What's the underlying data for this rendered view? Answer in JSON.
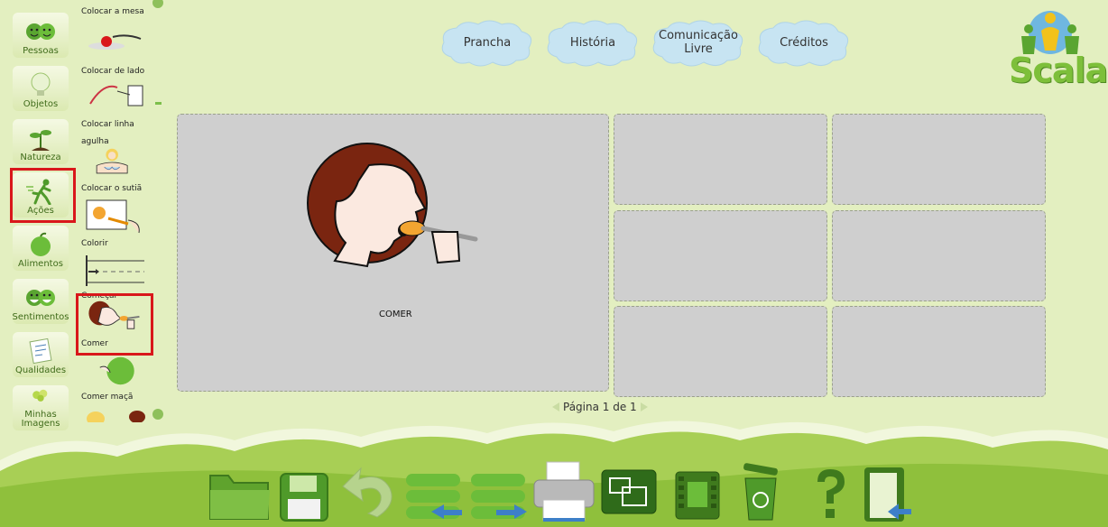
{
  "brand": {
    "logo_text": "Scala"
  },
  "nav_tabs": [
    {
      "label": "Prancha"
    },
    {
      "label": "História"
    },
    {
      "label": "Comunicação Livre"
    },
    {
      "label": "Créditos"
    }
  ],
  "categories": [
    {
      "label": "Pessoas",
      "icon": "people-icon"
    },
    {
      "label": "Objetos",
      "icon": "lightbulb-icon"
    },
    {
      "label": "Natureza",
      "icon": "plant-icon"
    },
    {
      "label": "Ações",
      "icon": "running-person-icon",
      "selected": true
    },
    {
      "label": "Alimentos",
      "icon": "apple-icon"
    },
    {
      "label": "Sentimentos",
      "icon": "faces-icon"
    },
    {
      "label": "Qualidades",
      "icon": "note-icon"
    },
    {
      "label": "Minhas Imagens",
      "icon": "balloons-icon"
    }
  ],
  "symbols": [
    {
      "label": "Colocar a mesa"
    },
    {
      "label": "Colocar de lado"
    },
    {
      "label": "Colocar linha agulha"
    },
    {
      "label": "Colocar o sutiã"
    },
    {
      "label": "Colorir"
    },
    {
      "label": "Começar"
    },
    {
      "label": "Comer",
      "selected": true
    },
    {
      "label": "Comer maçã"
    }
  ],
  "board": {
    "main_cell_label": "COMER",
    "pagination": "Página 1 de 1"
  },
  "toolbar": [
    {
      "name": "open-folder-button",
      "icon": "folder-icon"
    },
    {
      "name": "save-button",
      "icon": "floppy-disk-icon"
    },
    {
      "name": "undo-button",
      "icon": "undo-arrow-icon"
    },
    {
      "name": "shift-left-button",
      "icon": "rows-left-icon"
    },
    {
      "name": "shift-right-button",
      "icon": "rows-right-icon"
    },
    {
      "name": "print-button",
      "icon": "printer-icon"
    },
    {
      "name": "resize-button",
      "icon": "resize-icon"
    },
    {
      "name": "film-button",
      "icon": "film-icon"
    },
    {
      "name": "recycle-bin-button",
      "icon": "trash-icon"
    },
    {
      "name": "help-button",
      "icon": "question-mark-icon"
    },
    {
      "name": "exit-button",
      "icon": "exit-door-icon"
    }
  ],
  "colors": {
    "background": "#e3efc0",
    "accent_green": "#5aa531",
    "selection_red": "#d9171b",
    "cloud_blue": "#c7e4f2",
    "cell_gray": "#cfcfcf"
  }
}
